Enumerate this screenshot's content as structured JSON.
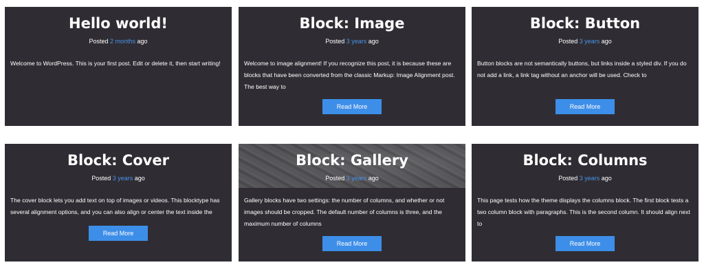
{
  "posts": [
    {
      "title": "Hello world!",
      "posted_prefix": "Posted",
      "date_link": "2 months",
      "posted_suffix": "ago",
      "excerpt": "Welcome to WordPress. This is your first post. Edit or delete it, then start writing!"
    },
    {
      "title": "Block: Image",
      "posted_prefix": "Posted",
      "date_link": "3 years",
      "posted_suffix": "ago",
      "excerpt": "Welcome to image alignment! If you recognize this post, it is because these are blocks that have been converted from the classic Markup: Image Alignment post. The best way to",
      "button": "Read More"
    },
    {
      "title": "Block: Button",
      "posted_prefix": "Posted",
      "date_link": "3 years",
      "posted_suffix": "ago",
      "excerpt": "Button blocks are not semantically buttons, but links inside a styled div.  If you do not add a link, a link tag without an anchor will be used. Check to",
      "button": "Read More"
    },
    {
      "title": "Block: Cover",
      "posted_prefix": "Posted",
      "date_link": "3 years",
      "posted_suffix": "ago",
      "excerpt": "The cover block lets you add text on top of images or videos. This blocktype has several alignment options, and you can also align or center the text inside the",
      "button": "Read More"
    },
    {
      "title": "Block: Gallery",
      "posted_prefix": "Posted",
      "date_link": "3 years",
      "posted_suffix": "ago",
      "excerpt": "Gallery blocks have two settings: the number of columns, and whether or not images should be cropped. The default number of columns is three, and the maximum number of columns",
      "button": "Read More"
    },
    {
      "title": "Block: Columns",
      "posted_prefix": "Posted",
      "date_link": "3 years",
      "posted_suffix": "ago",
      "excerpt": "This page tests how the theme displays the columns block. The first block tests a two column block with paragraphs. This is the second column. It should align next to",
      "button": "Read More"
    }
  ]
}
